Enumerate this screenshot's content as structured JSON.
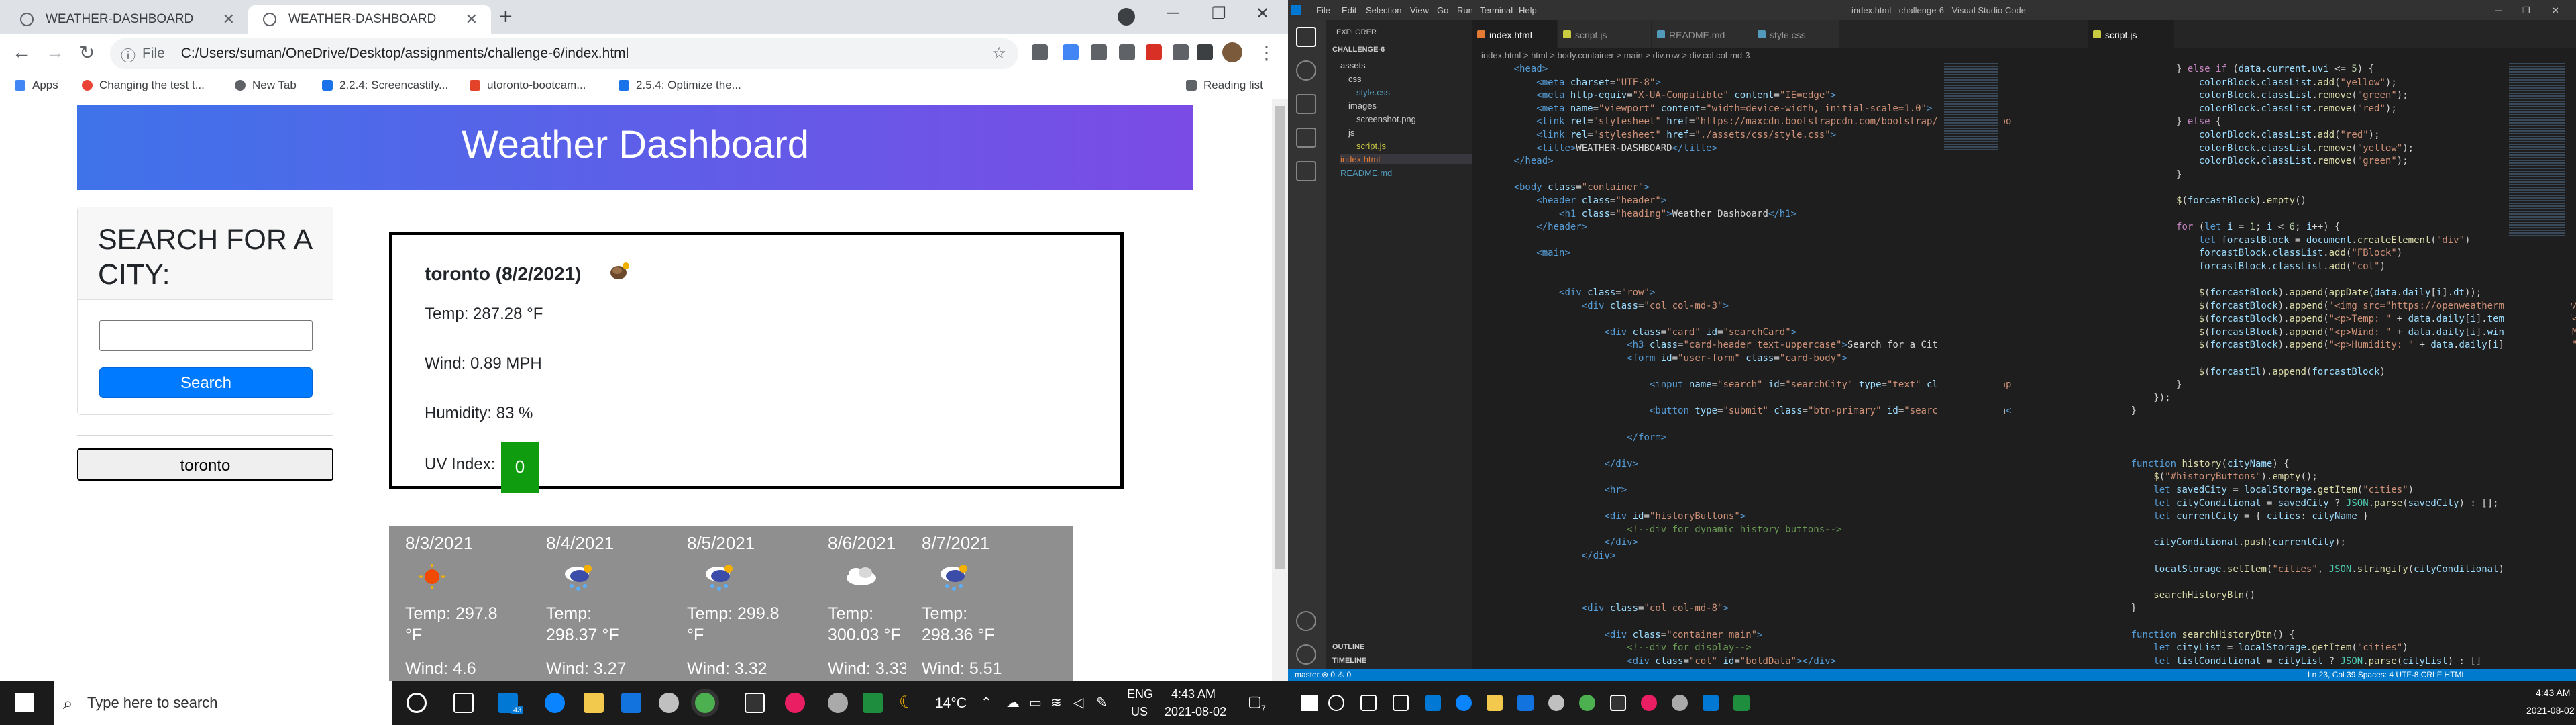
{
  "browser": {
    "tabs": [
      {
        "title": "WEATHER-DASHBOARD"
      },
      {
        "title": "WEATHER-DASHBOARD"
      }
    ],
    "new_tab": "+",
    "url": "C:/Users/suman/OneDrive/Desktop/assignments/challenge-6/index.html",
    "url_scheme": "File",
    "bookmarks": [
      {
        "label": "Apps"
      },
      {
        "label": "Changing the test t..."
      },
      {
        "label": "New Tab"
      },
      {
        "label": "2.2.4: Screencastify..."
      },
      {
        "label": "utoronto-bootcam..."
      },
      {
        "label": "2.5.4: Optimize the..."
      }
    ],
    "reading_list": "Reading list"
  },
  "dashboard": {
    "title": "Weather Dashboard",
    "search_heading": "Search for a City:",
    "search_value": "",
    "search_button": "Search",
    "history": [
      "toronto"
    ],
    "current": {
      "city": "toronto (8/2/2021)",
      "temp": "Temp: 287.28 °F",
      "wind": "Wind: 0.89 MPH",
      "humidity": "Humidity: 83 %",
      "uv_label": "UV Index:",
      "uv_value": "0"
    },
    "forecast": [
      {
        "date": "8/3/2021",
        "temp_a": "Temp: 297.8",
        "temp_b": "°F",
        "wind": "Wind: 4.6",
        "icon": "sun-icon"
      },
      {
        "date": "8/4/2021",
        "temp_a": "Temp:",
        "temp_b": "298.37 °F",
        "wind": "Wind: 3.27",
        "icon": "rain-cloud-icon"
      },
      {
        "date": "8/5/2021",
        "temp_a": "Temp: 299.8",
        "temp_b": "°F",
        "wind": "Wind: 3.32",
        "icon": "rain-cloud-icon"
      },
      {
        "date": "8/6/2021",
        "temp_a": "Temp:",
        "temp_b": "300.03 °F",
        "wind": "Wind: 3.33",
        "icon": "cloud-icon"
      },
      {
        "date": "8/7/2021",
        "temp_a": "Temp:",
        "temp_b": "298.36 °F",
        "wind": "Wind: 5.51",
        "icon": "rain-cloud-icon"
      }
    ]
  },
  "vscode": {
    "title": "index.html - challenge-6 - Visual Studio Code",
    "menu": [
      "File",
      "Edit",
      "Selection",
      "View",
      "Go",
      "Run",
      "Terminal",
      "Help"
    ],
    "explorer_title": "EXPLORER",
    "folder": "CHALLENGE-6",
    "tree": [
      "assets",
      "css",
      "style.css",
      "images",
      "screenshot.png",
      "js",
      "script.js",
      "index.html",
      "README.md"
    ],
    "outline": "OUTLINE",
    "timeline": "TIMELINE",
    "editor_tabs": [
      "index.html",
      "script.js",
      "README.md",
      "style.css"
    ],
    "editor2_tab": "script.js",
    "breadcrumb": "index.html > html > body.container > main > div.row > div.col.col-md-3",
    "status_left": "master  ⊗ 0 ⚠ 0",
    "status_right": "Ln 23, Col 39   Spaces: 4   UTF-8   CRLF   HTML"
  },
  "taskbar": {
    "search_placeholder": "Type here to search",
    "badge": "43",
    "weather": "14°C",
    "lang": "ENG",
    "region": "US",
    "time": "4:43 AM",
    "date": "2021-08-02",
    "notif": "7"
  }
}
